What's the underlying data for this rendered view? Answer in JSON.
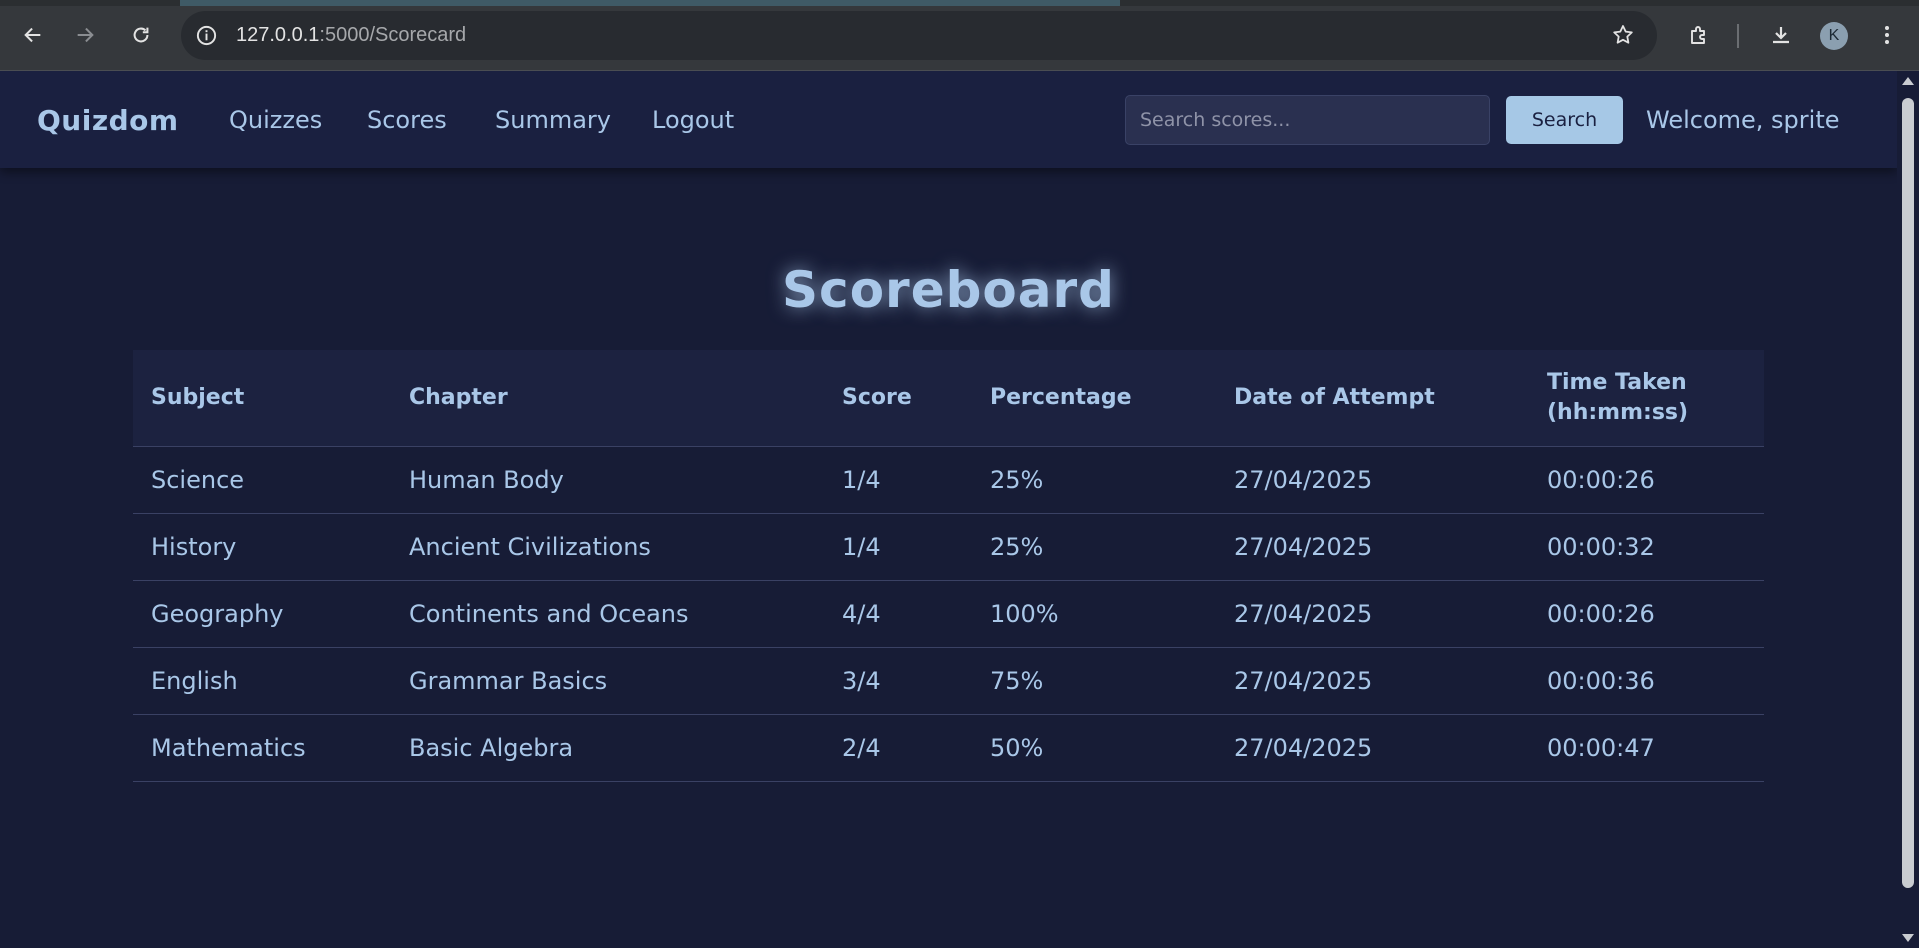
{
  "browser": {
    "url_host": "127.0.0.1",
    "url_path": ":5000/Scorecard",
    "profile_initial": "K"
  },
  "navbar": {
    "brand": "Quizdom",
    "links": [
      "Quizzes",
      "Scores",
      "Summary",
      "Logout"
    ],
    "search_placeholder": "Search scores...",
    "search_button": "Search",
    "welcome": "Welcome, sprite"
  },
  "main": {
    "title": "Scoreboard",
    "table": {
      "headers": [
        "Subject",
        "Chapter",
        "Score",
        "Percentage",
        "Date of Attempt",
        "Time Taken (hh:mm:ss)"
      ],
      "rows": [
        [
          "Science",
          "Human Body",
          "1/4",
          "25%",
          "27/04/2025",
          "00:00:26"
        ],
        [
          "History",
          "Ancient Civilizations",
          "1/4",
          "25%",
          "27/04/2025",
          "00:00:32"
        ],
        [
          "Geography",
          "Continents and Oceans",
          "4/4",
          "100%",
          "27/04/2025",
          "00:00:26"
        ],
        [
          "English",
          "Grammar Basics",
          "3/4",
          "75%",
          "27/04/2025",
          "00:00:36"
        ],
        [
          "Mathematics",
          "Basic Algebra",
          "2/4",
          "50%",
          "27/04/2025",
          "00:00:47"
        ]
      ]
    }
  },
  "colors": {
    "page_bg": "#171c36",
    "navbar_bg": "#1a2040",
    "accent": "#a9c7e8",
    "button_bg": "#a6c8e6"
  },
  "icons": [
    "back-arrow-icon",
    "forward-arrow-icon",
    "reload-icon",
    "site-info-icon",
    "bookmark-star-icon",
    "extensions-icon",
    "download-icon",
    "menu-dots-icon"
  ]
}
